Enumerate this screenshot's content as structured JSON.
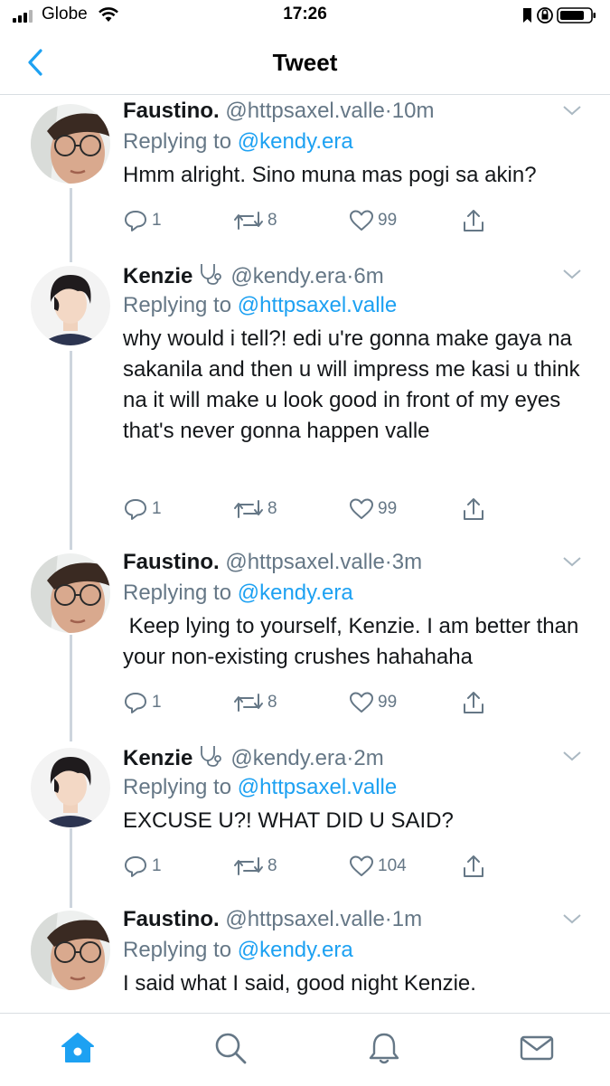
{
  "status_bar": {
    "carrier": "Globe",
    "time": "17:26"
  },
  "nav": {
    "title": "Tweet"
  },
  "tweets": [
    {
      "name": "Faustino.",
      "handle": "@httpsaxel.valle",
      "time": "10m",
      "replying_label": "Replying to",
      "replying_to": "@kendy.era",
      "text": "Hmm alright. Sino muna mas pogi sa akin?",
      "replies": "1",
      "retweets": "8",
      "likes": "99"
    },
    {
      "name": "Kenzie",
      "handle": "@kendy.era",
      "time": "6m",
      "replying_label": "Replying to",
      "replying_to": "@httpsaxel.valle",
      "text": "why would i tell?! edi u're gonna make gaya na sakanila and then u will impress me kasi u think na it will make u look good in front of my eyes that's never gonna happen valle",
      "replies": "1",
      "retweets": "8",
      "likes": "99"
    },
    {
      "name": "Faustino.",
      "handle": "@httpsaxel.valle",
      "time": "3m",
      "replying_label": "Replying to",
      "replying_to": "@kendy.era",
      "text": " Keep lying to yourself, Kenzie. I am better than your non-existing crushes hahahaha",
      "replies": "1",
      "retweets": "8",
      "likes": "99"
    },
    {
      "name": "Kenzie",
      "handle": "@kendy.era",
      "time": "2m",
      "replying_label": "Replying to",
      "replying_to": "@httpsaxel.valle",
      "text": "EXCUSE U?! WHAT DID U SAID?",
      "replies": "1",
      "retweets": "8",
      "likes": "104"
    },
    {
      "name": "Faustino.",
      "handle": "@httpsaxel.valle",
      "time": "1m",
      "replying_label": "Replying to",
      "replying_to": "@kendy.era",
      "text": "I said what I said, good night Kenzie."
    }
  ],
  "separator": "·",
  "colors": {
    "accent": "#1da1f2",
    "muted": "#657786",
    "text": "#14171a"
  },
  "tab_bar": [
    "home-icon",
    "search-icon",
    "notifications-icon",
    "messages-icon"
  ]
}
